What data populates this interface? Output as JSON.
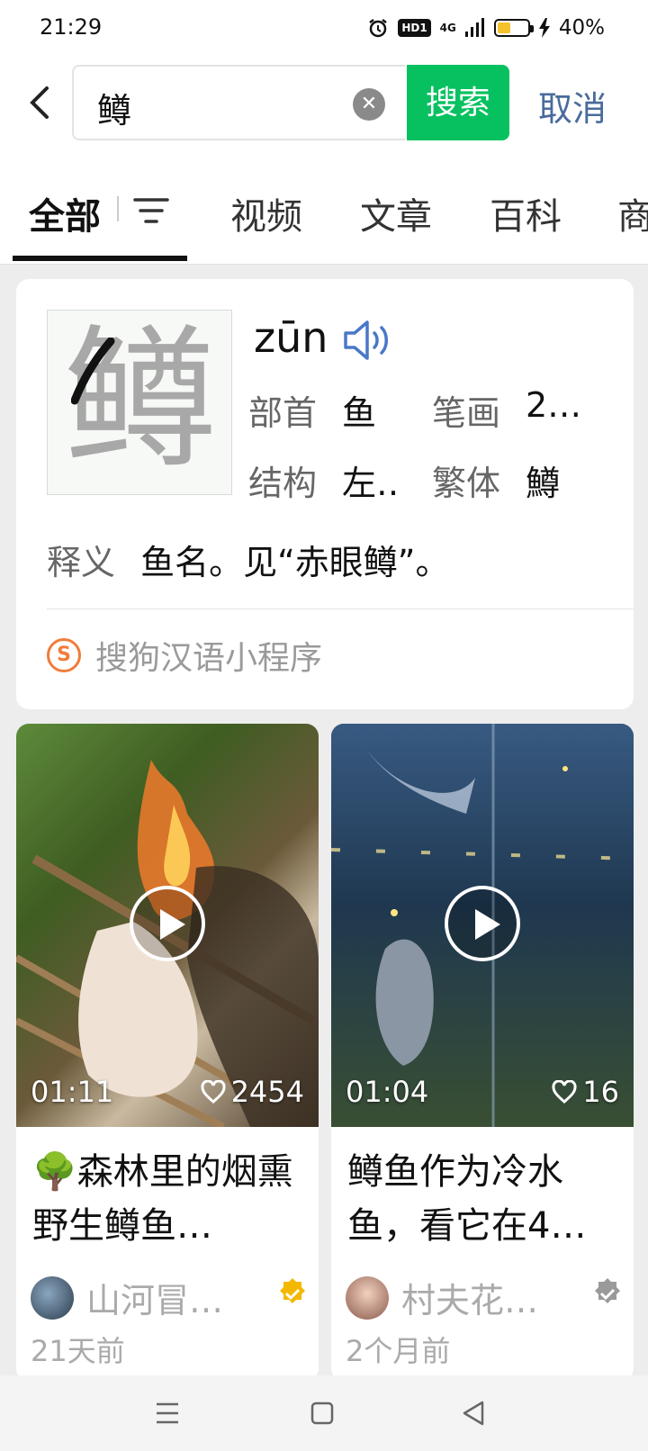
{
  "status_bar": {
    "time": "21:29",
    "network": "4G",
    "hd": "HD1",
    "battery": "40%",
    "battery_level": 0.4
  },
  "search": {
    "query": "鳟",
    "clear_icon": "clear-icon",
    "search_button": "搜索",
    "cancel": "取消"
  },
  "tabs": [
    {
      "label": "全部",
      "active": true
    },
    {
      "label": "视频"
    },
    {
      "label": "文章"
    },
    {
      "label": "百科"
    },
    {
      "label": "商"
    }
  ],
  "dictionary": {
    "character": "鳟",
    "pinyin": "zūn",
    "radical_label": "部首",
    "radical": "鱼",
    "strokes_label": "笔画",
    "strokes": "2…",
    "structure_label": "结构",
    "structure": "左‥",
    "traditional_label": "繁体",
    "traditional": "鱒",
    "meaning_label": "释义",
    "meaning": "鱼名。见“赤眼鳟”。",
    "source": "搜狗汉语小程序"
  },
  "videos": [
    {
      "duration": "01:11",
      "likes": "2454",
      "title": "🌳森林里的烟熏野生鳟鱼…",
      "author": "山河冒…",
      "time": "21天前",
      "verified_color": "#f5b800"
    },
    {
      "duration": "01:04",
      "likes": "16",
      "title": "鳟鱼作为冷水鱼，看它在4…",
      "author": "村夫花…",
      "time": "2个月前",
      "verified_color": "#9a9a9a"
    }
  ],
  "colors": {
    "accent": "#07c160",
    "link": "#4a6b9c"
  }
}
